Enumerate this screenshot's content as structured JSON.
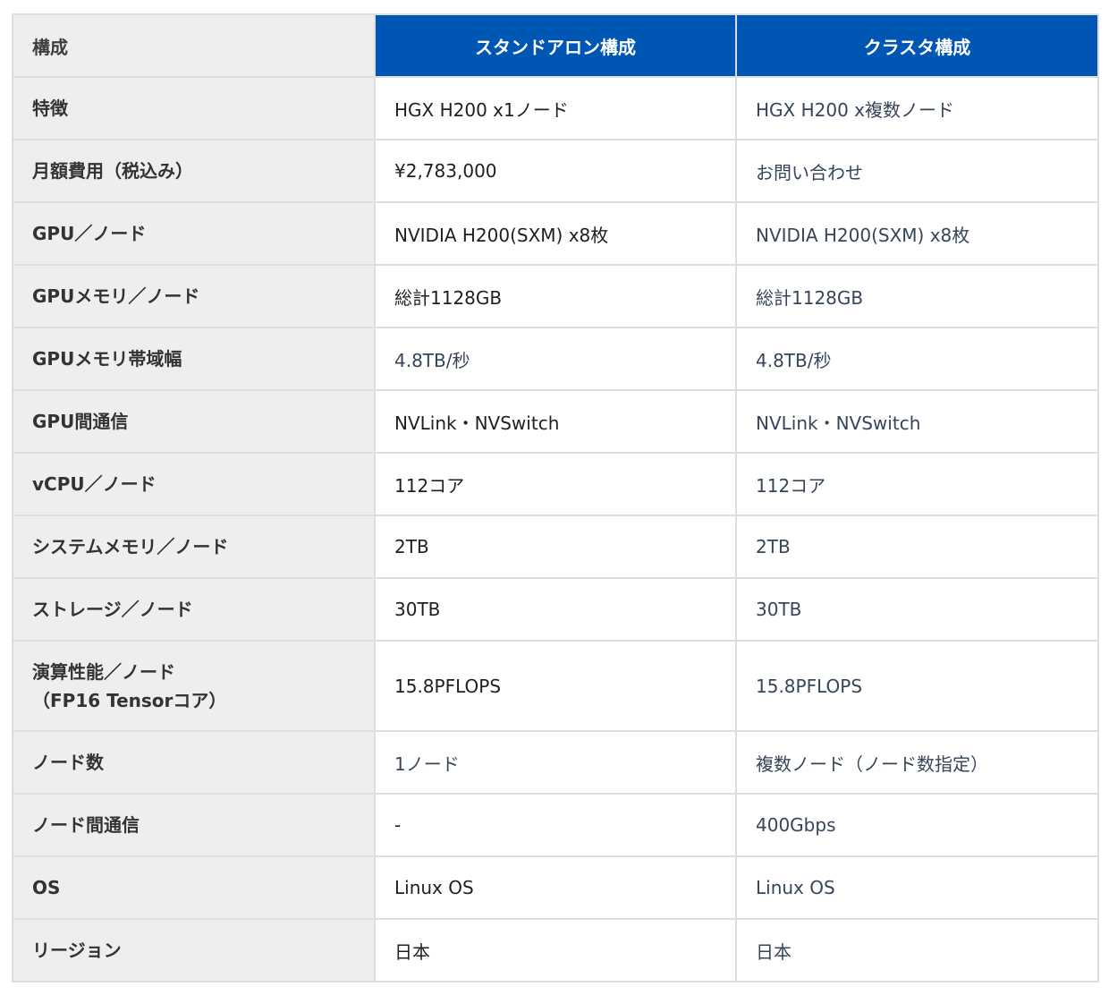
{
  "table": {
    "header": {
      "label": "構成",
      "standalone": "スタンドアロン構成",
      "cluster": "クラスタ構成"
    },
    "rows": [
      {
        "label": "特徴",
        "standalone": "HGX H200 x1ノード",
        "cluster": "HGX H200 x複数ノード"
      },
      {
        "label": "月額費用（税込み）",
        "standalone": "¥2,783,000",
        "cluster": "お問い合わせ"
      },
      {
        "label": "GPU／ノード",
        "standalone": "NVIDIA H200(SXM) x8枚",
        "cluster": "NVIDIA H200(SXM) x8枚"
      },
      {
        "label": "GPUメモリ／ノード",
        "standalone": "総計1128GB",
        "cluster": "総計1128GB"
      },
      {
        "label": "GPUメモリ帯域幅",
        "standalone": "4.8TB/秒",
        "cluster": "4.8TB/秒"
      },
      {
        "label": "GPU間通信",
        "standalone": "NVLink・NVSwitch",
        "cluster": "NVLink・NVSwitch"
      },
      {
        "label": "vCPU／ノード",
        "standalone": "112コア",
        "cluster": "112コア"
      },
      {
        "label": "システムメモリ／ノード",
        "standalone": "2TB",
        "cluster": "2TB"
      },
      {
        "label": "ストレージ／ノード",
        "standalone": "30TB",
        "cluster": "30TB"
      },
      {
        "label_line1": "演算性能／ノード",
        "label_line2": "（FP16 Tensorコア）",
        "standalone": "15.8PFLOPS",
        "cluster": "15.8PFLOPS"
      },
      {
        "label": "ノード数",
        "standalone": "1ノード",
        "cluster": "複数ノード（ノード数指定）"
      },
      {
        "label": "ノード間通信",
        "standalone": "-",
        "cluster": "400Gbps"
      },
      {
        "label": "OS",
        "standalone": "Linux OS",
        "cluster": "Linux OS"
      },
      {
        "label": "リージョン",
        "standalone": "日本",
        "cluster": "日本"
      }
    ]
  }
}
